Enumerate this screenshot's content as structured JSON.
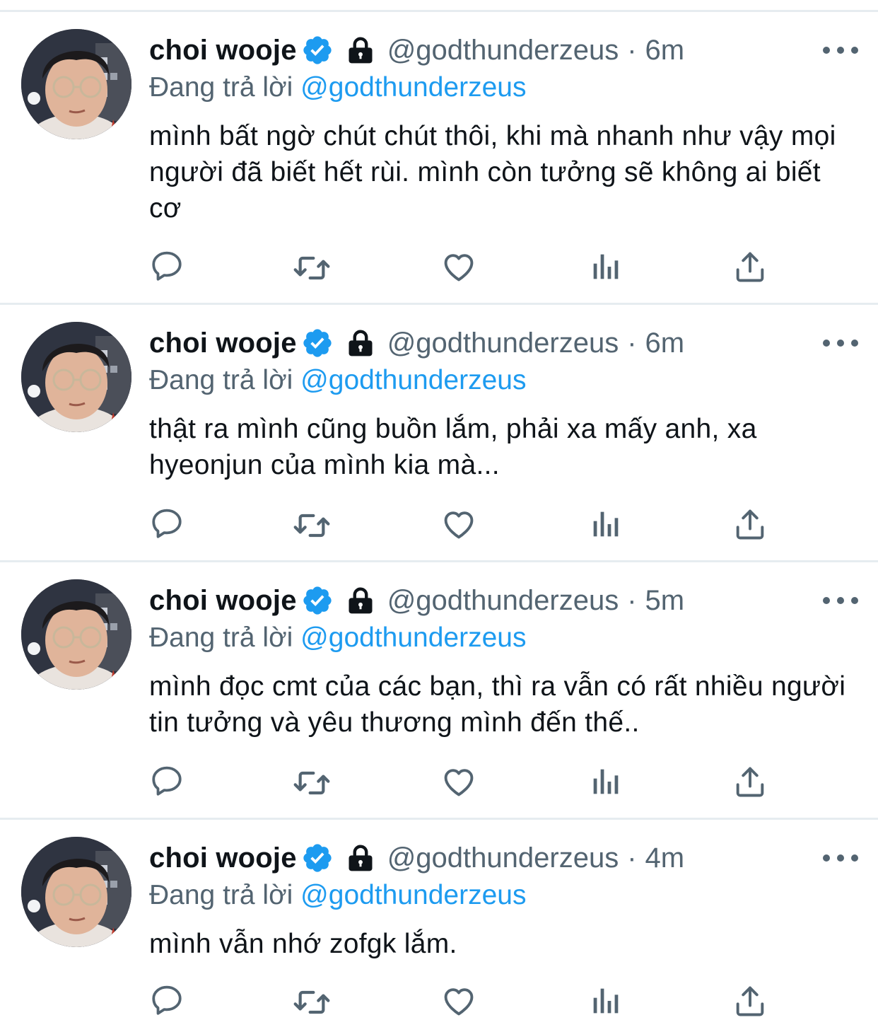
{
  "tweets": [
    {
      "author": {
        "display_name": "choi wooje",
        "handle": "@godthunderzeus"
      },
      "separator": "·",
      "time": "6m",
      "reply_label": "Đang trả lời",
      "reply_to": "@godthunderzeus",
      "text": "mình bất ngờ chút chút thôi, khi mà nhanh như vậy mọi người đã biết hết rùi. mình còn tưởng sẽ không ai biết cơ"
    },
    {
      "author": {
        "display_name": "choi wooje",
        "handle": "@godthunderzeus"
      },
      "separator": "·",
      "time": "6m",
      "reply_label": "Đang trả lời",
      "reply_to": "@godthunderzeus",
      "text": "thật ra mình cũng buồn lắm, phải xa mấy anh, xa hyeonjun của mình kia mà..."
    },
    {
      "author": {
        "display_name": "choi wooje",
        "handle": "@godthunderzeus"
      },
      "separator": "·",
      "time": "5m",
      "reply_label": "Đang trả lời",
      "reply_to": "@godthunderzeus",
      "text": "mình đọc cmt của các bạn, thì ra vẫn có rất nhiều người tin tưởng và yêu thương mình đến thế.."
    },
    {
      "author": {
        "display_name": "choi wooje",
        "handle": "@godthunderzeus"
      },
      "separator": "·",
      "time": "4m",
      "reply_label": "Đang trả lời",
      "reply_to": "@godthunderzeus",
      "text": "mình vẫn nhớ zofgk lắm."
    }
  ],
  "icons": {
    "verified": "verified-badge-icon",
    "lock": "lock-icon",
    "more": "more-icon",
    "reply": "reply-icon",
    "retweet": "retweet-icon",
    "like": "like-icon",
    "analytics": "analytics-icon",
    "share": "share-icon"
  },
  "colors": {
    "accent": "#1d9bf0",
    "text": "#0f1419",
    "muted": "#536471",
    "divider": "#e6ecf0"
  }
}
